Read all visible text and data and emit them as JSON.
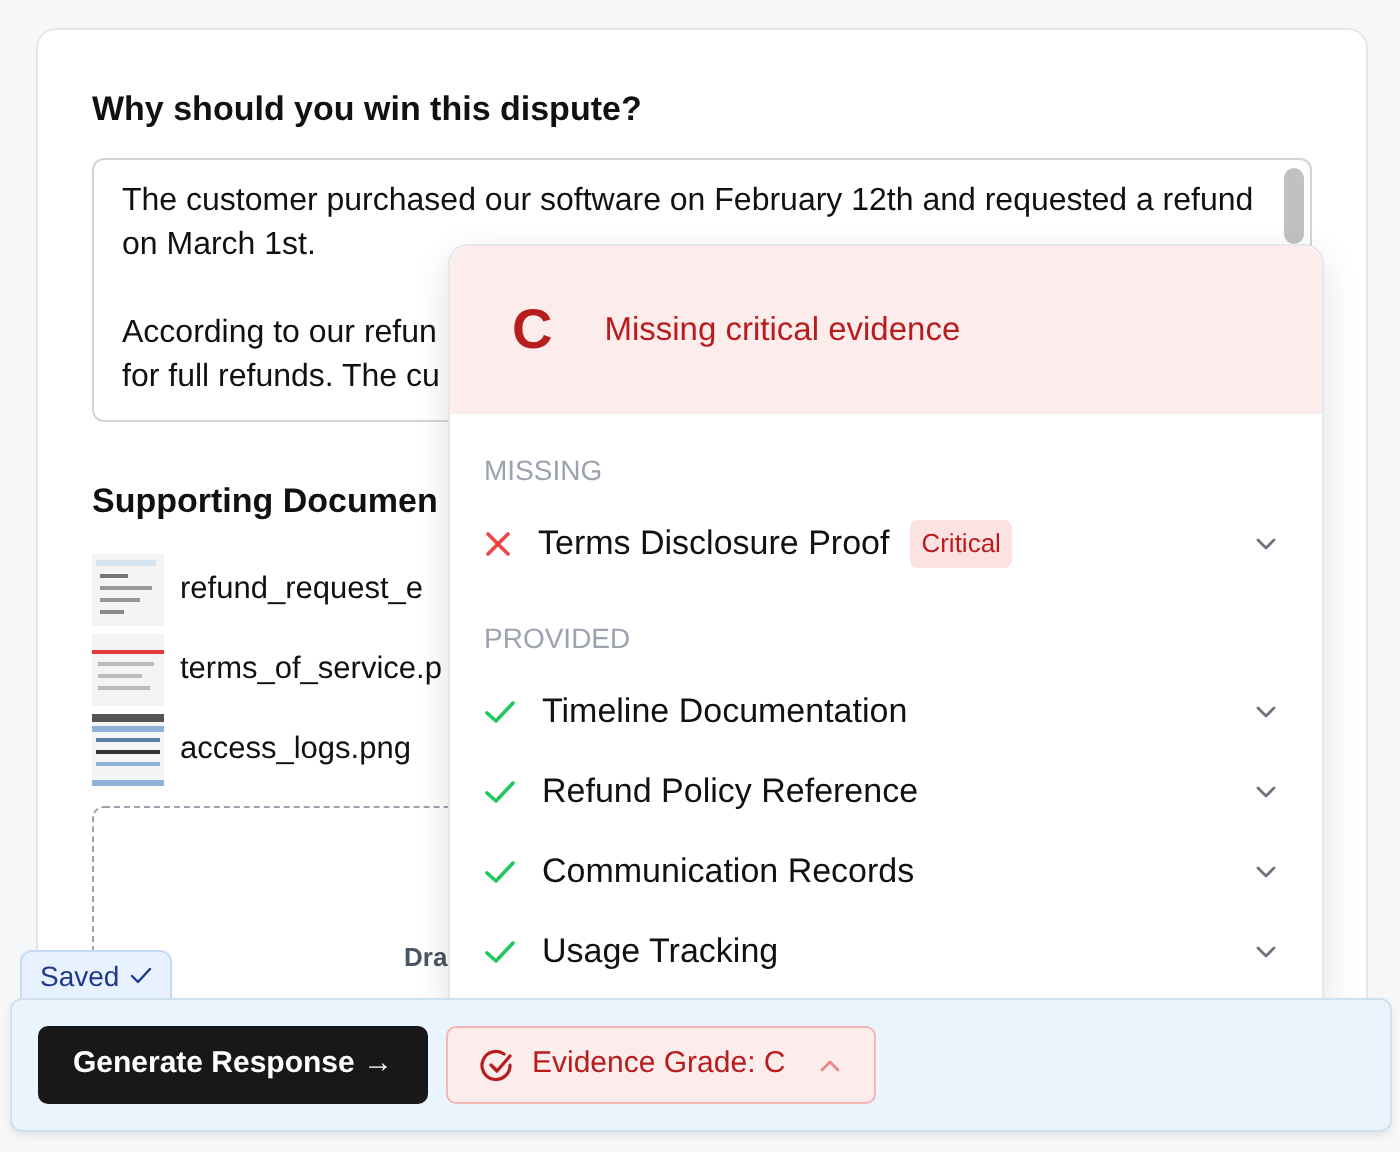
{
  "form": {
    "question": "Why should you win this dispute?",
    "answer_paragraphs": [
      [
        "The customer purchased our software on February 12th and requested a refund",
        "on March 1st."
      ],
      [
        "According to our refun",
        "for full refunds. The cu"
      ]
    ],
    "documents_heading": "Supporting Documen",
    "documents": [
      {
        "name": "refund_request_e"
      },
      {
        "name": "terms_of_service.p"
      },
      {
        "name": "access_logs.png"
      }
    ],
    "dropzone_text": "Dra"
  },
  "evidence_popover": {
    "grade": "C",
    "summary": "Missing critical evidence",
    "sections": [
      {
        "heading": "MISSING",
        "items": [
          {
            "label": "Terms Disclosure Proof",
            "kind": "missing",
            "tag": "Critical",
            "expanded": false
          }
        ]
      },
      {
        "heading": "PROVIDED",
        "items": [
          {
            "label": "Timeline Documentation",
            "kind": "provided",
            "expanded": false
          },
          {
            "label": "Refund Policy Reference",
            "kind": "provided",
            "expanded": false
          },
          {
            "label": "Communication Records",
            "kind": "provided",
            "expanded": false
          },
          {
            "label": "Usage Tracking",
            "kind": "provided",
            "expanded": false
          }
        ]
      }
    ]
  },
  "footer": {
    "saved_label": "Saved",
    "generate_button": "Generate Response →",
    "grade_button": {
      "label": "Evidence Grade: C",
      "expanded": true
    }
  }
}
